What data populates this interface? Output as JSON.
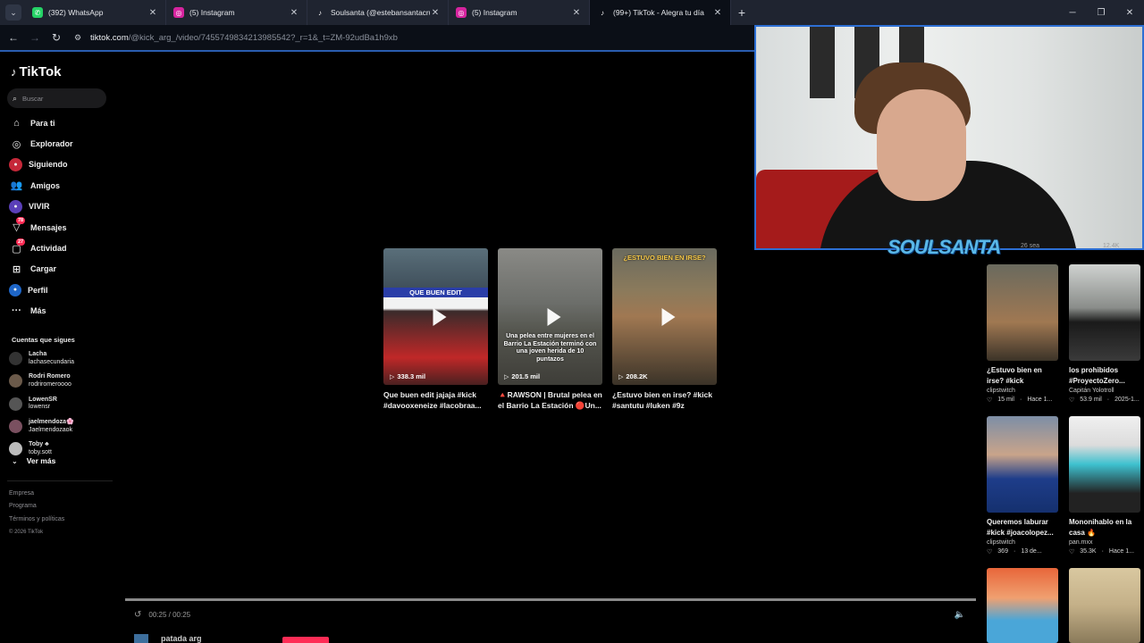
{
  "browser": {
    "tabs": [
      {
        "title": "(392) WhatsApp",
        "icon": "whatsapp-icon",
        "color": "#25d366"
      },
      {
        "title": "(5) Instagram",
        "icon": "instagram-icon",
        "color": "#d6249f"
      },
      {
        "title": "Soulsanta (@estebansantacruz",
        "icon": "tiktok-icon",
        "color": "#111111"
      },
      {
        "title": "(5) Instagram",
        "icon": "instagram-icon",
        "color": "#d6249f"
      },
      {
        "title": "(99+) TikTok - Alegra tu día",
        "icon": "tiktok-icon",
        "color": "#111111"
      }
    ],
    "url_host": "tiktok.com",
    "url_path": "/@kick_arg_/video/7455749834213985542?_r=1&_t=ZM-92udBa1h9xb"
  },
  "sidebar": {
    "logo": "TikTok",
    "search_placeholder": "Buscar",
    "nav": [
      {
        "label": "Para ti",
        "icon": "home-icon"
      },
      {
        "label": "Explorador",
        "icon": "compass-icon"
      },
      {
        "label": "Siguiendo",
        "icon": "following-avatar-icon"
      },
      {
        "label": "Amigos",
        "icon": "friends-icon"
      },
      {
        "label": "VIVIR",
        "icon": "live-icon"
      },
      {
        "label": "Mensajes",
        "icon": "send-icon",
        "badge": "78"
      },
      {
        "label": "Actividad",
        "icon": "activity-icon",
        "badge": "27"
      },
      {
        "label": "Cargar",
        "icon": "upload-icon"
      },
      {
        "label": "Perfil",
        "icon": "profile-icon"
      },
      {
        "label": "Más",
        "icon": "more-icon"
      }
    ],
    "following_header": "Cuentas que sigues",
    "following": [
      {
        "name": "Lacha",
        "handle": "lachasecundaria",
        "color": "#333333"
      },
      {
        "name": "Rodri Romero",
        "handle": "rodriromeroooo",
        "color": "#6b5a4a"
      },
      {
        "name": "LowenSR",
        "handle": "lowensr",
        "color": "#555555"
      },
      {
        "name": "jaelmendoza🌸",
        "handle": "Jaelmendozaok",
        "color": "#7a5060"
      },
      {
        "name": "Toby ♣",
        "handle": "toby.sott",
        "color": "#bcbcbc"
      }
    ],
    "see_more": "Ver más",
    "footer": [
      "Empresa",
      "Programa",
      "Términos y políticas"
    ],
    "copyright": "© 2026 TikTok"
  },
  "videos": [
    {
      "views": "338.3 mil",
      "caption": "Que buen edit jajaja #kick #davooxeneize #lacobraa...",
      "overlay": "QUE BUEN EDIT"
    },
    {
      "views": "201.5 mil",
      "caption": "🔺RAWSON | Brutal pelea en el Barrio La Estación 🔴Un...",
      "overlay": "Una pelea entre mujeres en el Barrio La Estación terminó con una joven herida de 10 puntazos"
    },
    {
      "views": "208.2K",
      "caption": "¿Estuvo bien en irse? #kick #santutu #luken #9z",
      "overlay": "¿ESTUVO BIEN EN IRSE?"
    }
  ],
  "webcam": {
    "logo": "SOULSANTA"
  },
  "right_videos": [
    {
      "caption": "¿Estuvo bien en irse? #kick #santutu...",
      "author": "clipstwitch",
      "likes": "15 mil",
      "time": "Hace 1..."
    },
    {
      "caption": "los prohibidos #ProyectoZero...",
      "author": "Capitán Yolotroll",
      "likes": "53.9 mil",
      "time": "2025-1..."
    },
    {
      "caption": "Queremos laburar #kick #joacolopez...",
      "author": "clipstwitch",
      "likes": "369",
      "time": "13 de..."
    },
    {
      "caption": "Mononihablo en la casa 🔥 #neopistea...",
      "author": "pan.mxx",
      "likes": "35.3K",
      "time": "Hace 1..."
    }
  ],
  "right_top_meta": [
    "26 sea",
    "12.4K"
  ],
  "player": {
    "time": "00:25 / 00:25",
    "progress_fraction": 1.0
  },
  "bottom": {
    "author": "patada arg"
  }
}
